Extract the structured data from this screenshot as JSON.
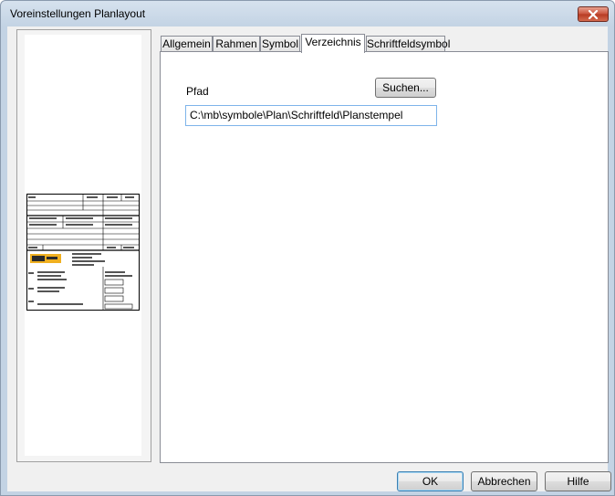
{
  "window": {
    "title": "Voreinstellungen Planlayout"
  },
  "tabs": [
    {
      "label": "Allgemein"
    },
    {
      "label": "Rahmen"
    },
    {
      "label": "Symbol"
    },
    {
      "label": "Verzeichnis"
    },
    {
      "label": "Schriftfeldsymbol"
    }
  ],
  "active_tab": "Verzeichnis",
  "directory": {
    "path_label": "Pfad",
    "browse_button": "Suchen...",
    "path_value": "C:\\mb\\symbole\\Plan\\Schriftfeld\\Planstempel"
  },
  "buttons": {
    "ok": "OK",
    "cancel": "Abbrechen",
    "help": "Hilfe"
  },
  "icons": {
    "close": "close-icon"
  },
  "colors": {
    "close_button": "#c9513a",
    "title_bar": "#c3d3e4",
    "stamp_logo": "#f0b020"
  }
}
